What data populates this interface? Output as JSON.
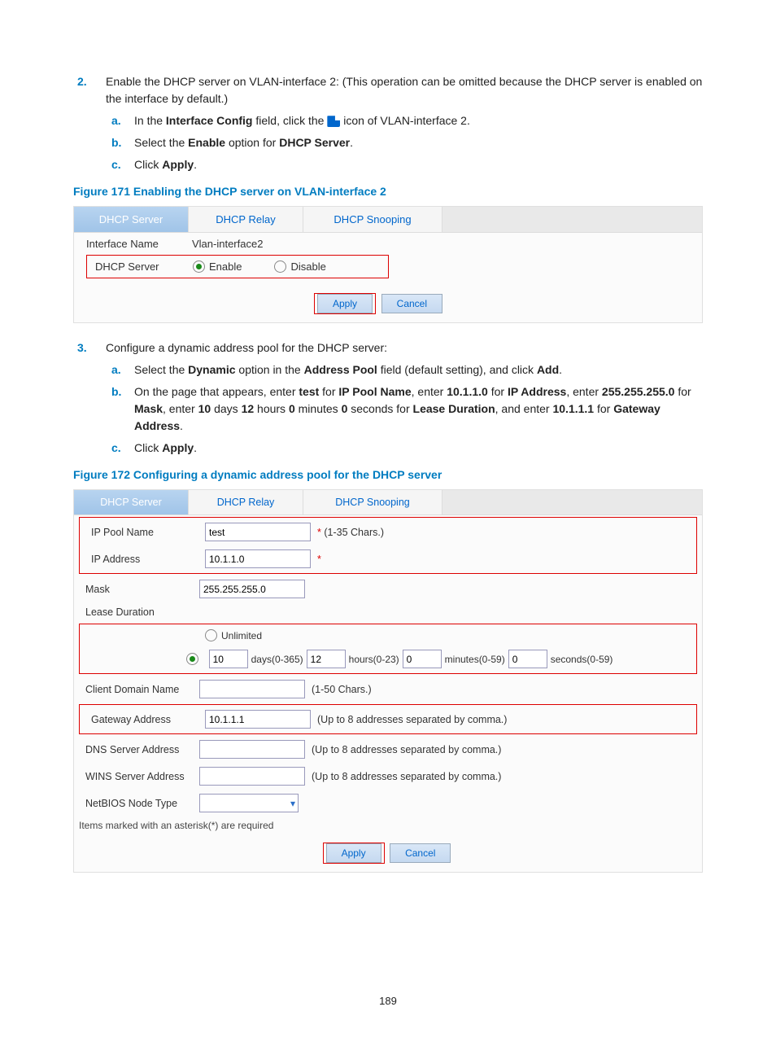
{
  "step2": {
    "num": "2.",
    "text_before": "Enable the DHCP server on VLAN-interface 2: (This operation can be omitted because the DHCP server is enabled on the interface by default.)",
    "a": {
      "let": "a.",
      "pre": "In the ",
      "b1": "Interface Config",
      "mid": " field, click the ",
      "post": " icon of VLAN-interface 2."
    },
    "b": {
      "let": "b.",
      "pre": "Select the ",
      "b1": "Enable",
      "mid": " option for ",
      "b2": "DHCP Server",
      "post": "."
    },
    "c": {
      "let": "c.",
      "pre": "Click ",
      "b1": "Apply",
      "post": "."
    }
  },
  "fig171": "Figure 171 Enabling the DHCP server on VLAN-interface 2",
  "shot1": {
    "tab1": "DHCP Server",
    "tab2": "DHCP Relay",
    "tab3": "DHCP Snooping",
    "ifname_l": "Interface Name",
    "ifname_v": "Vlan-interface2",
    "dhcps_l": "DHCP Server",
    "enable": "Enable",
    "disable": "Disable",
    "apply": "Apply",
    "cancel": "Cancel"
  },
  "step3": {
    "num": "3.",
    "text": "Configure a dynamic address pool for the DHCP server:",
    "a": {
      "let": "a.",
      "pre": "Select the ",
      "b1": "Dynamic",
      "mid": " option in the ",
      "b2": "Address Pool",
      "post1": " field (default setting), and click ",
      "b3": "Add",
      "post2": "."
    },
    "b": {
      "let": "b.",
      "pre": "On the page that appears, enter ",
      "b1": "test",
      "mid1": " for ",
      "b2": "IP Pool Name",
      "mid2": ", enter ",
      "b3": "10.1.1.0",
      "mid3": " for ",
      "b4": "IP Address",
      "mid4": ", enter ",
      "b5": "255.255.255.0",
      "mid5": " for ",
      "b6": "Mask",
      "mid6": ", enter ",
      "b7": "10",
      "mid7": " days ",
      "b8": "12",
      "mid8": " hours ",
      "b9": "0",
      "mid9": " minutes ",
      "b10": "0",
      "mid10": " seconds for ",
      "b11": "Lease Duration",
      "mid11": ", and enter ",
      "b12": "10.1.1.1",
      "mid12": " for ",
      "b13": "Gateway Address",
      "post": "."
    },
    "c": {
      "let": "c.",
      "pre": "Click ",
      "b1": "Apply",
      "post": "."
    }
  },
  "fig172": "Figure 172 Configuring a dynamic address pool for the DHCP server",
  "shot2": {
    "tab1": "DHCP Server",
    "tab2": "DHCP Relay",
    "tab3": "DHCP Snooping",
    "ipp_l": "IP Pool Name",
    "ipp_v": "test",
    "ipp_hint": "(1-35 Chars.)",
    "ipa_l": "IP Address",
    "ipa_v": "10.1.1.0",
    "mask_l": "Mask",
    "mask_v": "255.255.255.0",
    "lease_l": "Lease Duration",
    "unl": "Unlimited",
    "d_v": "10",
    "d_l": "days(0-365)",
    "h_v": "12",
    "h_l": "hours(0-23)",
    "m_v": "0",
    "m_l": "minutes(0-59)",
    "s_v": "0",
    "s_l": "seconds(0-59)",
    "cdn_l": "Client Domain Name",
    "cdn_hint": "(1-50 Chars.)",
    "gw_l": "Gateway Address",
    "gw_v": "10.1.1.1",
    "gw_hint": "(Up to 8 addresses separated by comma.)",
    "dns_l": "DNS Server Address",
    "dns_hint": "(Up to 8 addresses separated by comma.)",
    "wins_l": "WINS Server Address",
    "wins_hint": "(Up to 8 addresses separated by comma.)",
    "nb_l": "NetBIOS Node Type",
    "foot": "Items marked with an asterisk(*) are required",
    "apply": "Apply",
    "cancel": "Cancel"
  },
  "page": "189"
}
